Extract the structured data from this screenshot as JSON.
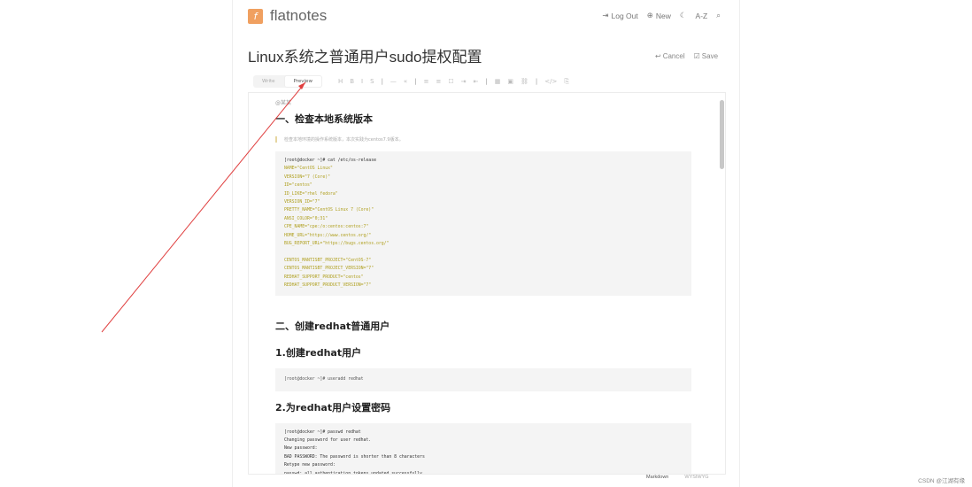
{
  "app": {
    "name": "flatnotes",
    "logo_glyph": "f"
  },
  "topnav": {
    "logout": "Log Out",
    "new": "New",
    "sort": "A-Z"
  },
  "note": {
    "title": "Linux系统之普通用户sudo提权配置"
  },
  "actions": {
    "cancel": "Cancel",
    "save": "Save"
  },
  "editor_tabs": {
    "write": "Write",
    "preview": "Preview"
  },
  "toolbar_tools": [
    "H",
    "B",
    "I",
    "S",
    "—",
    "«",
    "≡",
    "≡",
    "☐",
    "⇥",
    "⇤",
    "▦",
    "▣",
    "⛓",
    "</>",
    "⎘"
  ],
  "doc": {
    "author": "@某某",
    "h1": "一、检查本地系统版本",
    "quote": "检查本地环境的操作系统版本，本次实践为centos7.9版本。",
    "code1": [
      [
        "p",
        "[root@docker ~]# cat /etc/os-release"
      ],
      [
        "k",
        "NAME=\"CentOS Linux\""
      ],
      [
        "k",
        "VERSION=\"7 (Core)\""
      ],
      [
        "k",
        "ID=\"centos\""
      ],
      [
        "k",
        "ID_LIKE=\"rhel fedora\""
      ],
      [
        "k",
        "VERSION_ID=\"7\""
      ],
      [
        "k",
        "PRETTY_NAME=\"CentOS Linux 7 (Core)\""
      ],
      [
        "k",
        "ANSI_COLOR=\"0;31\""
      ],
      [
        "k",
        "CPE_NAME=\"cpe:/o:centos:centos:7\""
      ],
      [
        "k",
        "HOME_URL=\"https://www.centos.org/\""
      ],
      [
        "k",
        "BUG_REPORT_URL=\"https://bugs.centos.org/\""
      ],
      [
        "k",
        ""
      ],
      [
        "k",
        "CENTOS_MANTISBT_PROJECT=\"CentOS-7\""
      ],
      [
        "k",
        "CENTOS_MANTISBT_PROJECT_VERSION=\"7\""
      ],
      [
        "k",
        "REDHAT_SUPPORT_PRODUCT=\"centos\""
      ],
      [
        "k",
        "REDHAT_SUPPORT_PRODUCT_VERSION=\"7\""
      ]
    ],
    "h2": "二、创建redhat普通用户",
    "h3a": "1.创建redhat用户",
    "code2": "[root@docker ~]# useradd redhat",
    "h3b": "2.为redhat用户设置密码",
    "code3": [
      "[root@docker ~]# passwd redhat",
      "Changing password for user redhat.",
      "New password:",
      "BAD PASSWORD: The password is shorter than 8 characters",
      "Retype new password:",
      "passwd: all authentication tokens updated successfully."
    ]
  },
  "footer": {
    "markdown": "Markdown",
    "wysiwyg": "WYSIWYG"
  },
  "watermark": "CSDN @江湖有缘",
  "colors": {
    "logo": "#f0a060",
    "code_key": "#b0a020",
    "arrow": "#e04040"
  }
}
